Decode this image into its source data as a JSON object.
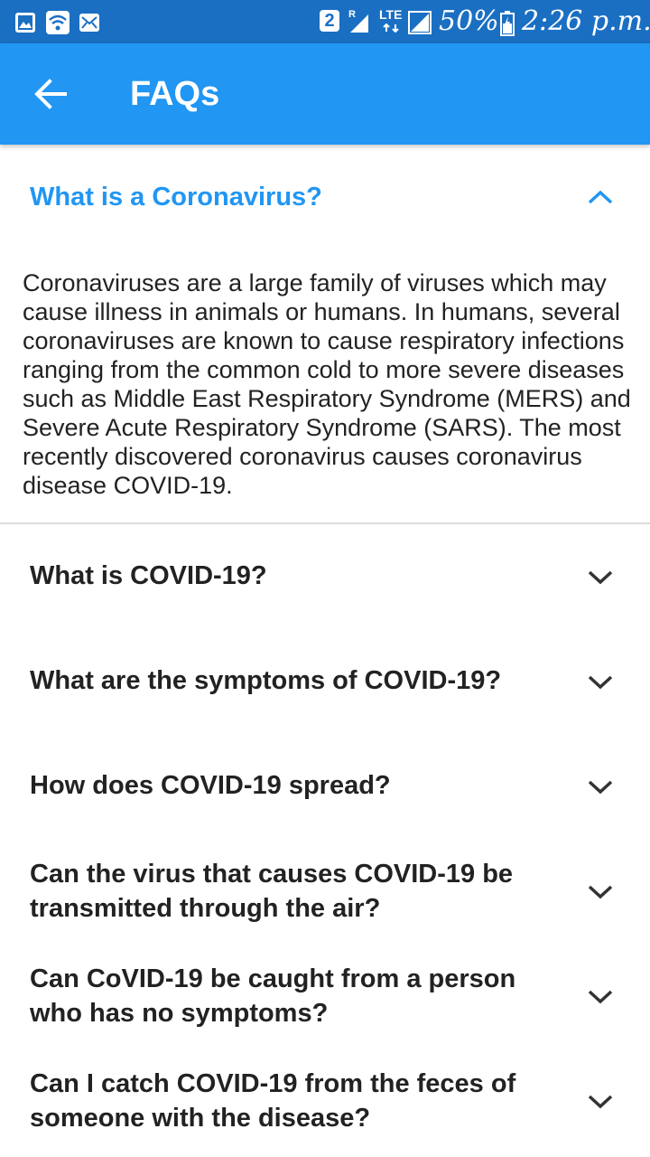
{
  "status_bar": {
    "sim_slot": "2",
    "roaming": "R",
    "network": "LTE",
    "battery": "50%",
    "time": "2:26 p.m."
  },
  "app_bar": {
    "title": "FAQs",
    "back_icon": "arrow-back-icon"
  },
  "colors": {
    "status_bar": "#1a6fc2",
    "app_bar": "#2196f3",
    "accent": "#2196f3",
    "text": "#222222",
    "divider": "#dcdcdc",
    "chevron": "#333333"
  },
  "faqs": [
    {
      "question": "What is a Coronavirus?",
      "expanded": true,
      "answer": "Coronaviruses are a large family of viruses which may cause illness in animals or humans.  In humans, several coronaviruses are known to cause respiratory infections ranging from the common cold to more severe diseases such as Middle East Respiratory Syndrome (MERS) and Severe Acute Respiratory Syndrome (SARS). The most recently discovered coronavirus causes coronavirus disease COVID-19."
    },
    {
      "question": "What is COVID-19?",
      "expanded": false
    },
    {
      "question": "What are the symptoms of COVID-19?",
      "expanded": false
    },
    {
      "question": "How does COVID-19 spread?",
      "expanded": false
    },
    {
      "question": "Can the virus that causes COVID-19 be transmitted through the air?",
      "expanded": false
    },
    {
      "question": "Can CoVID-19 be caught from a person who has no symptoms?",
      "expanded": false
    },
    {
      "question": "Can I catch COVID-19 from the feces of someone with the disease?",
      "expanded": false
    }
  ]
}
